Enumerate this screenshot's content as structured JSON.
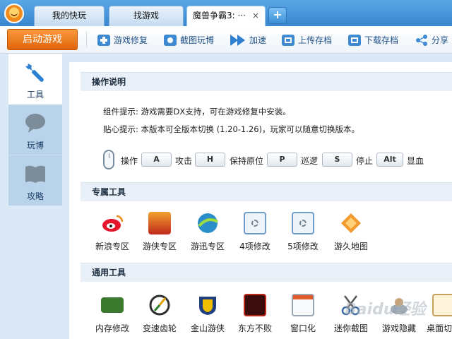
{
  "titlebar": {
    "logo_icon": "orange-mascot-logo",
    "tabs": [
      {
        "label": "我的快玩"
      },
      {
        "label": "找游戏"
      },
      {
        "label": "魔兽争霸3: ···",
        "close": "×"
      }
    ],
    "add_tab": "+"
  },
  "toolbar": {
    "start_label": "启动游戏",
    "items": [
      {
        "label": "游戏修复",
        "icon": "medkit-icon"
      },
      {
        "label": "截图玩博",
        "icon": "camera-icon"
      },
      {
        "label": "加速",
        "icon": "fast-forward-icon"
      },
      {
        "label": "上传存档",
        "icon": "upload-save-icon"
      },
      {
        "label": "下载存档",
        "icon": "download-save-icon"
      },
      {
        "label": "分享",
        "icon": "share-icon"
      }
    ]
  },
  "leftnav": {
    "items": [
      {
        "label": "工具",
        "icon": "wrench-icon"
      },
      {
        "label": "玩博",
        "icon": "speech-bubble-icon"
      },
      {
        "label": "攻略",
        "icon": "book-icon"
      }
    ]
  },
  "instructions": {
    "title": "操作说明",
    "component_tip": "组件提示: 游戏需要DX支持，可在游戏修复中安装。",
    "friendly_tip": "贴心提示: 本版本可全版本切换 (1.20-1.26)，玩家可以随意切换版本。",
    "controls": {
      "operate": "操作",
      "keys": [
        {
          "key": "A",
          "action": "攻击"
        },
        {
          "key": "H",
          "action": "保持原位"
        },
        {
          "key": "P",
          "action": "巡逻"
        },
        {
          "key": "S",
          "action": "停止"
        },
        {
          "key": "Alt",
          "action": "显血"
        }
      ]
    }
  },
  "exclusive_tools": {
    "title": "专属工具",
    "items": [
      {
        "label": "新浪专区",
        "icon": "sina-weibo-icon"
      },
      {
        "label": "游侠专区",
        "icon": "ali213-icon"
      },
      {
        "label": "游迅专区",
        "icon": "yxdown-icon"
      },
      {
        "label": "4项修改",
        "icon": "gear-window-icon"
      },
      {
        "label": "5项修改",
        "icon": "gear-window-icon"
      },
      {
        "label": "游久地图",
        "icon": "uuu9-map-icon"
      }
    ]
  },
  "common_tools": {
    "title": "通用工具",
    "items": [
      {
        "label": "内存修改",
        "icon": "memory-chip-icon"
      },
      {
        "label": "变速齿轮",
        "icon": "speed-gear-icon"
      },
      {
        "label": "金山游侠",
        "icon": "kingsoft-youxia-icon"
      },
      {
        "label": "东方不败",
        "icon": "dongfang-bubai-icon"
      },
      {
        "label": "窗口化",
        "icon": "window-icon"
      },
      {
        "label": "迷你截图",
        "icon": "scissors-icon"
      },
      {
        "label": "游戏隐藏",
        "icon": "hide-game-icon"
      },
      {
        "label": "桌面切",
        "icon": "desktop-switch-icon"
      }
    ]
  },
  "watermark": "Baidu经验",
  "colors": {
    "titlebar": "#3a86cf",
    "start_button": "#e1630a",
    "link_text": "#1f4f86",
    "section_bg": "#e9f0f7"
  }
}
